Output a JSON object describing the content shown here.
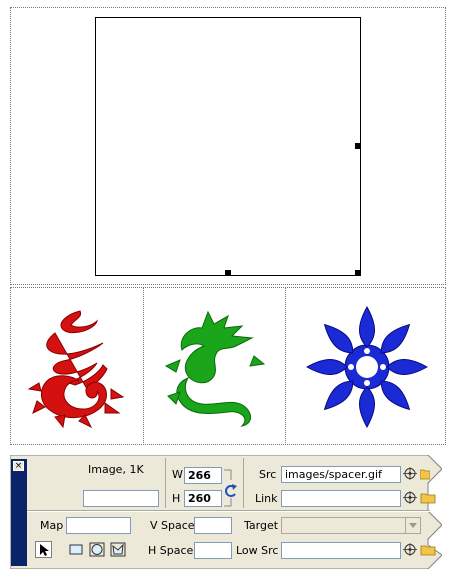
{
  "document": {
    "spacer_image": {
      "width": 266,
      "height": 260
    }
  },
  "inspector": {
    "close_label": "×",
    "image_info": "Image, 1K",
    "image_name_value": "",
    "w_label": "W",
    "w_value": "266",
    "h_label": "H",
    "h_value": "260",
    "src_label": "Src",
    "src_value": "images/spacer.gif",
    "link_label": "Link",
    "link_value": "",
    "map_label": "Map",
    "map_value": "",
    "vspace_label": "V Space",
    "vspace_value": "",
    "target_label": "Target",
    "target_value": "",
    "hspace_label": "H Space",
    "hspace_value": "",
    "lowsrc_label": "Low Src",
    "lowsrc_value": ""
  },
  "icons": [
    "point-to-file-icon",
    "folder-icon",
    "refresh-size-icon",
    "pointer-tool-icon",
    "rect-hotspot-icon",
    "circle-hotspot-icon",
    "polygon-hotspot-icon",
    "dropdown-arrow-icon"
  ],
  "colors": {
    "red_dragon": "#d41010",
    "green_dragon": "#1aa51a",
    "blue_flower": "#1a2ad4",
    "panel_bg": "#ece9d8",
    "panel_strip": "#0a246a"
  }
}
